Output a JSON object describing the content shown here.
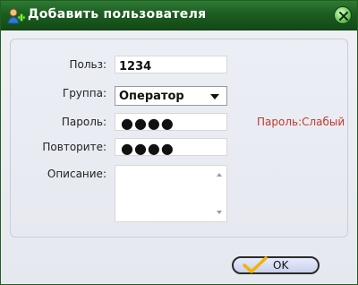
{
  "dialog": {
    "title": "Добавить пользователя",
    "title_icon": "add-user-icon",
    "close_icon": "close-icon"
  },
  "form": {
    "user_label": "Польз:",
    "user_value": "1234",
    "group_label": "Группа:",
    "group_selected": "Оператор",
    "password_label": "Пароль:",
    "password_masked": "●●●●",
    "repeat_label": "Повторите:",
    "repeat_masked": "●●●●",
    "strength_text": "Пароль:Слабый",
    "description_label": "Описание:",
    "description_value": ""
  },
  "buttons": {
    "ok_label": "OK",
    "ok_icon": "checkmark-icon"
  },
  "colors": {
    "titlebar": "#1c5d21",
    "strength_weak": "#c0392b",
    "ok_check": "#f2b400"
  }
}
